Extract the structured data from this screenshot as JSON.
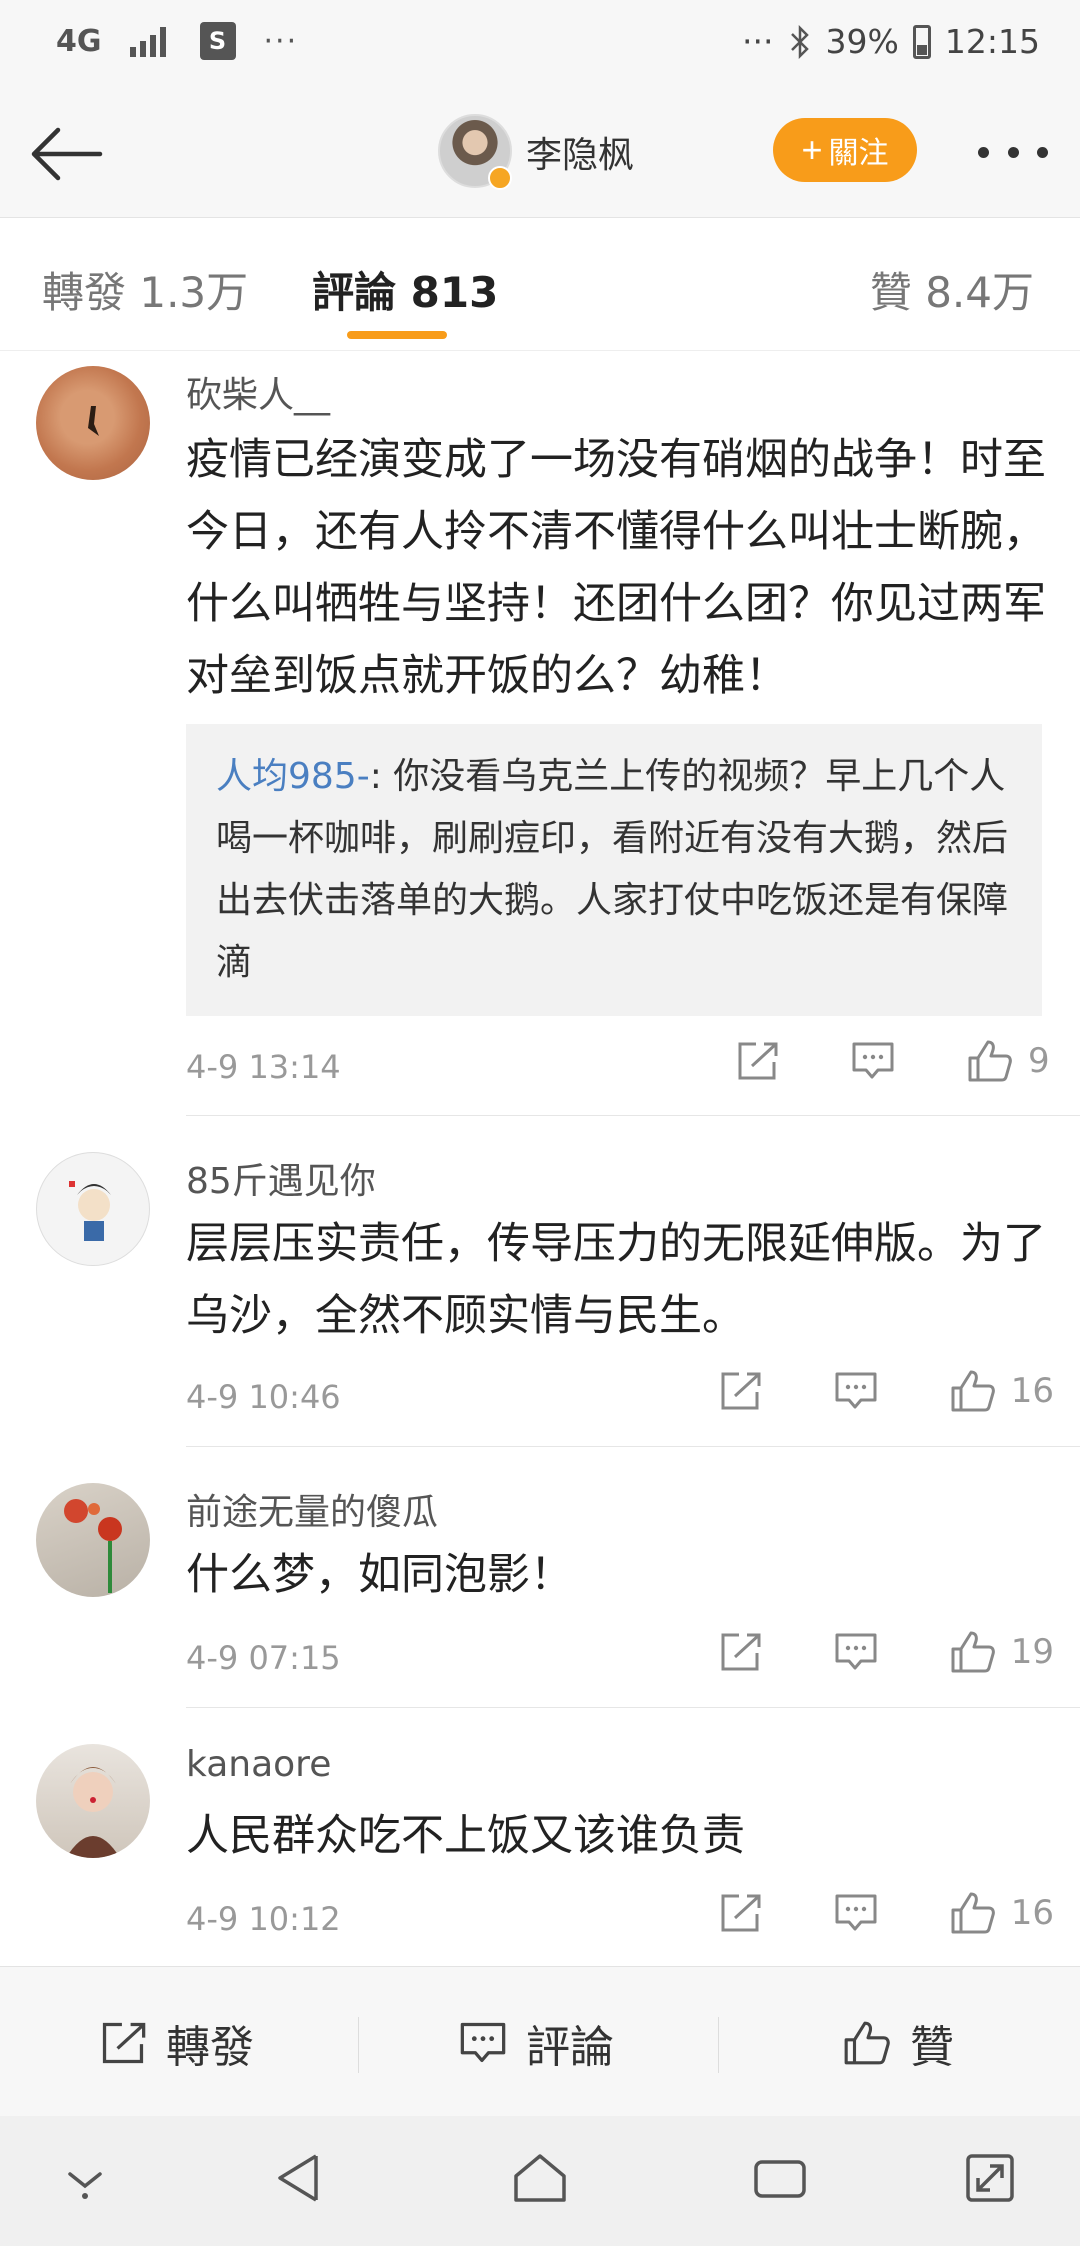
{
  "status_bar": {
    "network": "4G",
    "shop_icon_letter": "S",
    "left_dots": "···",
    "right_dots": "···",
    "battery": "39%",
    "time": "12:15"
  },
  "header": {
    "title": "李隐枫",
    "follow_label": "關注",
    "icons": [
      "back-arrow-icon",
      "verified-badge-icon",
      "plus-icon",
      "more-dots-icon"
    ]
  },
  "tabs": {
    "repost": "轉發 1.3万",
    "comments": "評論 813",
    "likes": "贊 8.4万"
  },
  "comments": [
    {
      "user": "砍柴人__",
      "text": "疫情已经演变成了一场没有硝烟的战争！时至今日，还有人拎不清不懂得什么叫壮士断腕，什么叫牺牲与坚持！还团什么团？你见过两军对垒到饭点就开饭的么？幼稚！",
      "reply": {
        "user": "人均985-",
        "text": ": 你没看乌克兰上传的视频？早上几个人喝一杯咖啡，刷刷痘印，看附近有没有大鹅，然后出去伏击落单的大鹅。人家打仗中吃饭还是有保障滴"
      },
      "time": "4-9 13:14",
      "likes": "9"
    },
    {
      "user": "85斤遇见你",
      "text": "层层压实责任，传导压力的无限延伸版。为了乌沙，全然不顾实情与民生。",
      "time": "4-9 10:46",
      "likes": "16"
    },
    {
      "user": "前途无量的傻瓜",
      "text": "什么梦，如同泡影！",
      "time": "4-9 07:15",
      "likes": "19"
    },
    {
      "user": "kanaore",
      "text": "人民群众吃不上饭又该谁负责",
      "time": "4-9 10:12",
      "likes": "16"
    }
  ],
  "bottom_bar": {
    "repost_label": "轉發",
    "comment_label": "評論",
    "like_label": "贊"
  },
  "colors": {
    "accent": "#f89c1a",
    "reply_user": "#4a7fc1",
    "meta_text": "#999999"
  }
}
